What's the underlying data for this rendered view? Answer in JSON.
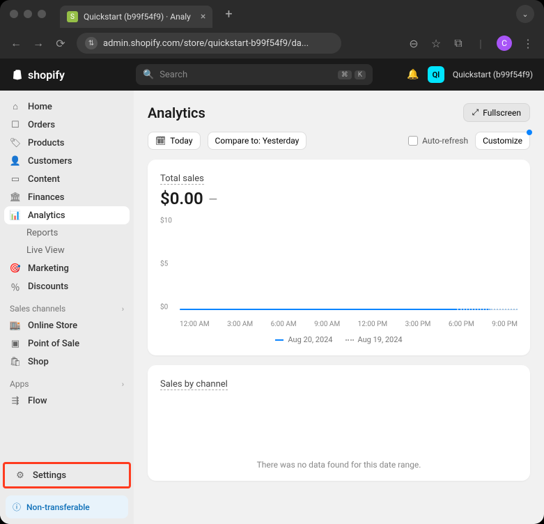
{
  "browser": {
    "tab_title": "Quickstart (b99f54f9) · Analy",
    "url": "admin.shopify.com/store/quickstart-b99f54f9/da...",
    "avatar_letter": "C"
  },
  "topbar": {
    "logo_text": "shopify",
    "search_placeholder": "Search",
    "kbd1": "⌘",
    "kbd2": "K",
    "user_badge": "Ql",
    "store_name": "Quickstart (b99f54f9)"
  },
  "sidebar": {
    "items": [
      {
        "label": "Home"
      },
      {
        "label": "Orders"
      },
      {
        "label": "Products"
      },
      {
        "label": "Customers"
      },
      {
        "label": "Content"
      },
      {
        "label": "Finances"
      },
      {
        "label": "Analytics"
      },
      {
        "label": "Reports"
      },
      {
        "label": "Live View"
      },
      {
        "label": "Marketing"
      },
      {
        "label": "Discounts"
      }
    ],
    "section_channels": "Sales channels",
    "channels": [
      {
        "label": "Online Store"
      },
      {
        "label": "Point of Sale"
      },
      {
        "label": "Shop"
      }
    ],
    "section_apps": "Apps",
    "apps": [
      {
        "label": "Flow"
      }
    ],
    "settings_label": "Settings",
    "non_transferable": "Non-transferable"
  },
  "page": {
    "title": "Analytics",
    "fullscreen": "Fullscreen",
    "today": "Today",
    "compare": "Compare to: Yesterday",
    "auto_refresh": "Auto-refresh",
    "customize": "Customize"
  },
  "total_sales_card": {
    "label": "Total sales",
    "value": "$0.00",
    "legend_a": "Aug 20, 2024",
    "legend_b": "Aug 19, 2024"
  },
  "sales_channel_card": {
    "label": "Sales by channel",
    "empty": "There was no data found for this date range."
  },
  "chart_data": {
    "type": "line",
    "title": "Total sales",
    "ylabel": "$",
    "ylim": [
      0,
      10
    ],
    "yticks": [
      0,
      5,
      10
    ],
    "x_categories": [
      "12:00 AM",
      "3:00 AM",
      "6:00 AM",
      "9:00 AM",
      "12:00 PM",
      "3:00 PM",
      "6:00 PM",
      "9:00 PM"
    ],
    "series": [
      {
        "name": "Aug 20, 2024",
        "values": [
          0,
          0,
          0,
          0,
          0,
          0,
          0,
          0
        ]
      },
      {
        "name": "Aug 19, 2024",
        "values": [
          0,
          0,
          0,
          0,
          0,
          0,
          0,
          0
        ]
      }
    ]
  }
}
